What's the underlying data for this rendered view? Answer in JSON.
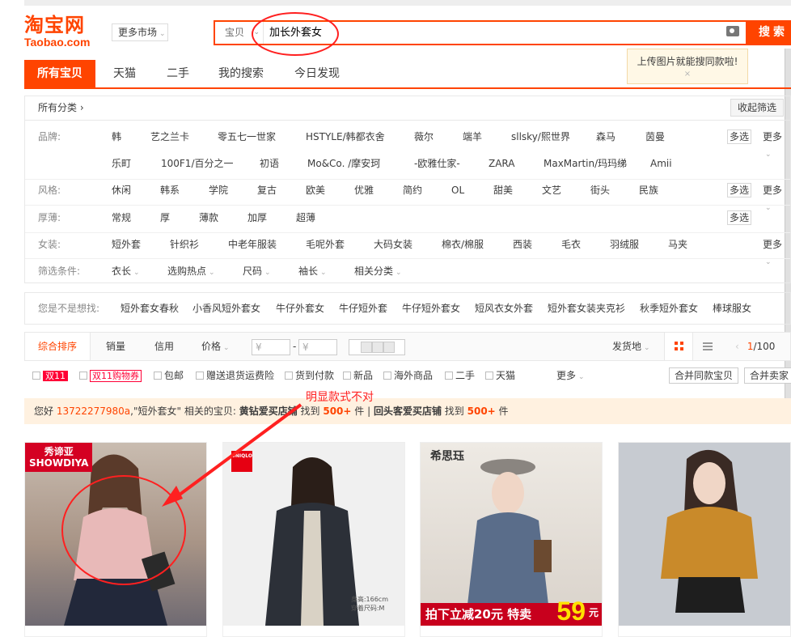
{
  "header": {
    "logo_cn": "淘宝网",
    "logo_en": "Taobao.com",
    "market_label": "更多市场",
    "search_type": "宝贝",
    "search_query": "加长外套女",
    "search_button": "搜索",
    "tooltip_text": "上传图片就能搜同款啦!",
    "tooltip_close": "×"
  },
  "tabs": [
    {
      "label": "所有宝贝",
      "active": true
    },
    {
      "label": "天猫"
    },
    {
      "label": "二手"
    },
    {
      "label": "我的搜索"
    },
    {
      "label": "今日发现"
    }
  ],
  "category": {
    "label": "所有分类 ›",
    "collapse_label": "收起筛选"
  },
  "filters": {
    "brand": {
      "label": "品牌:",
      "values": [
        "韩",
        "艺之兰卡",
        "零五七一世家",
        "HSTYLE/韩都衣舍",
        "薇尔",
        "端羊",
        "sllsky/熙世界",
        "森马",
        "茵曼"
      ],
      "values2": [
        "乐町",
        "100F1/百分之一",
        "初语",
        "Mo&Co. /摩安珂",
        "-欧雅仕家-",
        "ZARA",
        "MaxMartin/玛玛绨",
        "Amii"
      ]
    },
    "style": {
      "label": "风格:",
      "values": [
        "休闲",
        "韩系",
        "学院",
        "复古",
        "欧美",
        "优雅",
        "简约",
        "OL",
        "甜美",
        "文艺",
        "街头",
        "民族"
      ]
    },
    "thickness": {
      "label": "厚薄:",
      "values": [
        "常规",
        "厚",
        "薄款",
        "加厚",
        "超薄"
      ]
    },
    "womenswear": {
      "label": "女装:",
      "values": [
        "短外套",
        "针织衫",
        "中老年服装",
        "毛呢外套",
        "大码女装",
        "棉衣/棉服",
        "西装",
        "毛衣",
        "羽绒服",
        "马夹"
      ]
    },
    "conditions": {
      "label": "筛选条件:",
      "values": [
        "衣长",
        "选购热点",
        "尺码",
        "袖长",
        "相关分类"
      ]
    },
    "multi_label": "多选",
    "more_label": "更多",
    "dropdown_glyph": "⌄"
  },
  "suggestions": {
    "label": "您是不是想找:",
    "items": [
      "短外套女春秋",
      "小香风短外套女",
      "牛仔外套女",
      "牛仔短外套",
      "牛仔短外套女",
      "短风衣女外套",
      "短外套女装夹克衫",
      "秋季短外套女",
      "棒球服女"
    ]
  },
  "sortbar": {
    "items": [
      "综合排序",
      "销量",
      "信用",
      "价格"
    ],
    "price_from": "¥",
    "price_to": "¥",
    "price_sep": "-",
    "ship_from": "发货地",
    "pager_prev": "‹",
    "pager_current": "1",
    "pager_total": "/100"
  },
  "checkboxes": {
    "tag11": "双11",
    "tag11_shop": "双11购物券",
    "items": [
      "包邮",
      "赠送退货运费险",
      "货到付款",
      "新品",
      "海外商品",
      "二手",
      "天猫"
    ],
    "more": "更多",
    "merge_same": "合并同款宝贝",
    "merge_seller": "合并卖家"
  },
  "notice": {
    "prefix": "您好 ",
    "user": "13722277980a",
    "mid": ",\"短外套女\" 相关的宝贝: ",
    "shop1": "黄钻爱买店铺",
    "find1": " 找到 ",
    "count1": "500+",
    "unit1": " 件  |  ",
    "shop2": "回头客爱买店铺",
    "find2": " 找到 ",
    "count2": "500+",
    "unit2": " 件"
  },
  "annotation": {
    "text": "明显款式不对"
  },
  "products": [
    {
      "brand": "秀谛亚\nSHOWDIYA",
      "bg": "#b8a79a"
    },
    {
      "brand": "UNIQLO",
      "bg": "#eeeeee",
      "note1": "身高:166cm",
      "note2": "穿着尺码:M"
    },
    {
      "brand": "希思珏",
      "promo": "拍下立减20元  特卖",
      "promo_num": "59",
      "promo_unit": "元",
      "bg": "#e3ddd6"
    },
    {
      "brand": "",
      "bg": "#c7cbd1"
    }
  ],
  "colors": {
    "accent": "#ff4400",
    "annotation": "#ff2020",
    "tmall": "#ff0036"
  }
}
